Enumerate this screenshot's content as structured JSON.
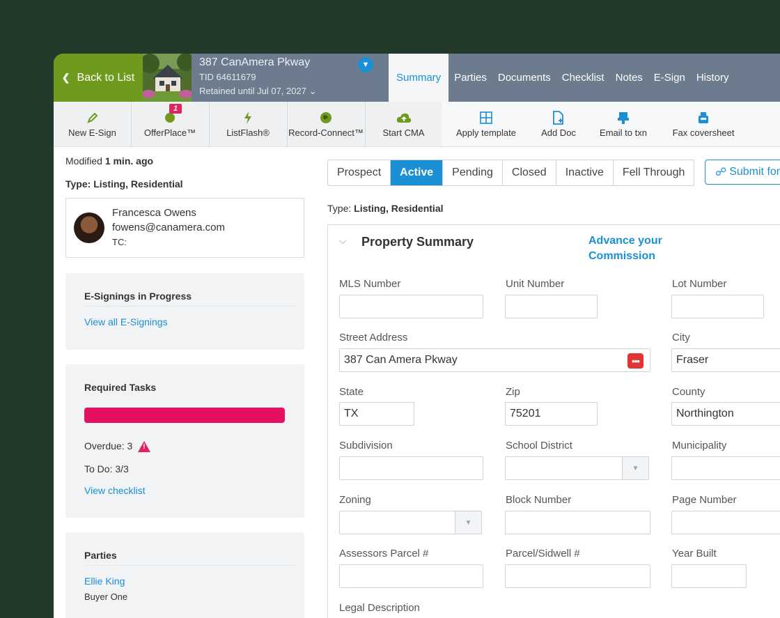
{
  "header": {
    "back_label": "Back to List",
    "address": "387 CanAmera Pkway",
    "tid": "TID 64611679",
    "retained": "Retained until Jul 07, 2027",
    "tabs": [
      "Summary",
      "Parties",
      "Documents",
      "Checklist",
      "Notes",
      "E-Sign",
      "History"
    ]
  },
  "toolbar": {
    "items": [
      "New E-Sign",
      "OfferPlace™",
      "ListFlash®",
      "Record-Connect™",
      "Start CMA",
      "Apply template",
      "Add Doc",
      "Email to txn",
      "Fax coversheet"
    ],
    "offer_badge": "1"
  },
  "sidebar": {
    "modified_prefix": "Modified ",
    "modified_value": "1 min. ago",
    "type_prefix": "Type: ",
    "type_value": "Listing, Residential",
    "agent": {
      "name": "Francesca Owens",
      "email": "fowens@canamera.com",
      "tc": "TC:"
    },
    "esign": {
      "title": "E-Signings in Progress",
      "link": "View all E-Signings"
    },
    "tasks": {
      "title": "Required Tasks",
      "overdue": "Overdue: 3",
      "todo": "To Do: 3/3",
      "link": "View checklist",
      "warn_icon": "!"
    },
    "parties": {
      "title": "Parties",
      "name": "Ellie King",
      "role": "Buyer One"
    }
  },
  "main": {
    "statuses": [
      "Prospect",
      "Active",
      "Pending",
      "Closed",
      "Inactive",
      "Fell Through"
    ],
    "submit": "Submit for",
    "type_prefix": "Type: ",
    "type_value": "Listing, Residential",
    "panel_title": "Property Summary",
    "advance_line1": "Advance your",
    "advance_line2": "Commission",
    "fields": {
      "mls": "MLS Number",
      "unit": "Unit Number",
      "lot": "Lot Number",
      "street": "Street Address",
      "street_value": "387 Can Amera Pkway",
      "city": "City",
      "city_value": "Fraser",
      "state": "State",
      "state_value": "TX",
      "zip": "Zip",
      "zip_value": "75201",
      "county": "County",
      "county_value": "Northington",
      "subdivision": "Subdivision",
      "school": "School District",
      "municipality": "Municipality",
      "zoning": "Zoning",
      "block": "Block Number",
      "page": "Page Number",
      "assessors": "Assessors Parcel #",
      "sidwell": "Parcel/Sidwell #",
      "year": "Year Built",
      "legal": "Legal Description"
    }
  },
  "colors": {
    "brand_green": "#6f9a1d",
    "accent_blue": "#1a8fd3",
    "alert_red": "#e5105f",
    "header_gray": "#6c7c8e",
    "background": "#233a2b"
  }
}
